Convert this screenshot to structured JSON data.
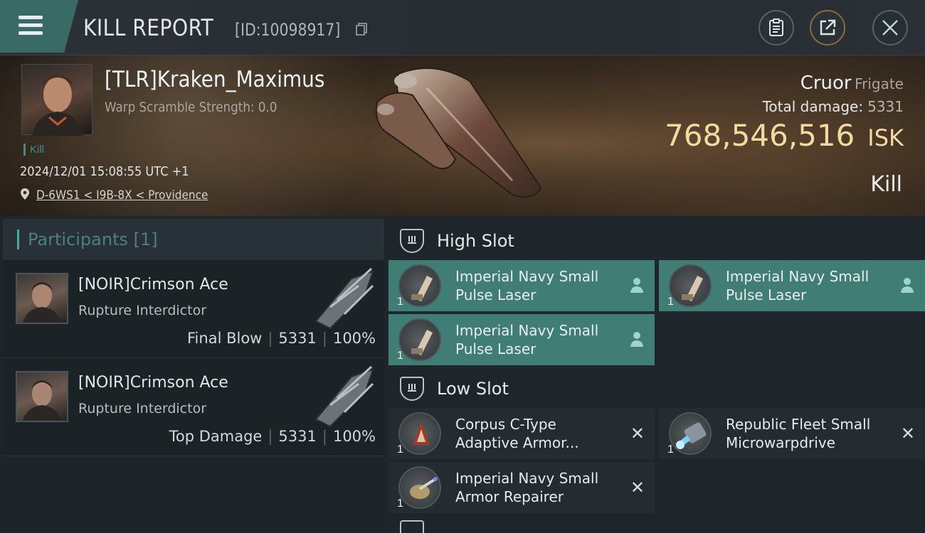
{
  "header": {
    "title": "KILL REPORT",
    "report_id": "[ID:10098917]"
  },
  "victim": {
    "pilot_name": "[TLR]Kraken_Maximus",
    "warp_scramble": "Warp Scramble Strength: 0.0",
    "kill_tag": "Kill",
    "datetime": "2024/12/01 15:08:55 UTC +1",
    "location": "D-6WS1 < I9B-8X < Providence",
    "ship_name": "Cruor",
    "ship_class": "Frigate",
    "total_damage_label": "Total damage:",
    "total_damage_value": "5331",
    "isk_value": "768,546,516",
    "isk_unit": "ISK",
    "result": "Kill"
  },
  "participants": {
    "header": "Participants [1]",
    "items": [
      {
        "name": "[NOIR]Crimson Ace",
        "ship": "Rupture Interdictor",
        "role": "Final Blow",
        "damage": "5331",
        "percent": "100%"
      },
      {
        "name": "[NOIR]Crimson Ace",
        "ship": "Rupture Interdictor",
        "role": "Top Damage",
        "damage": "5331",
        "percent": "100%"
      }
    ]
  },
  "fitting": {
    "high_slot_label": "High Slot",
    "low_slot_label": "Low Slot",
    "high_modules": [
      {
        "name": "Imperial Navy Small Pulse Laser",
        "qty": "1",
        "state": "dropped",
        "icon": "pulse-laser-icon"
      },
      {
        "name": "Imperial Navy Small Pulse Laser",
        "qty": "1",
        "state": "dropped",
        "icon": "pulse-laser-icon"
      },
      {
        "name": "Imperial Navy Small Pulse Laser",
        "qty": "1",
        "state": "dropped",
        "icon": "pulse-laser-icon"
      }
    ],
    "low_modules": [
      {
        "name": "Corpus C-Type Adaptive Armor...",
        "qty": "1",
        "state": "destroyed",
        "icon": "armor-hardener-icon"
      },
      {
        "name": "Republic Fleet Small Microwarpdrive",
        "qty": "1",
        "state": "destroyed",
        "icon": "microwarpdrive-icon"
      },
      {
        "name": "Imperial Navy Small Armor Repairer",
        "qty": "1",
        "state": "destroyed",
        "icon": "armor-repairer-icon"
      }
    ],
    "destroyed_mark": "✕"
  },
  "colors": {
    "accent_teal": "#3f7d75",
    "isk_gold": "#f3d9a2",
    "participants_header": "#4b827c"
  }
}
